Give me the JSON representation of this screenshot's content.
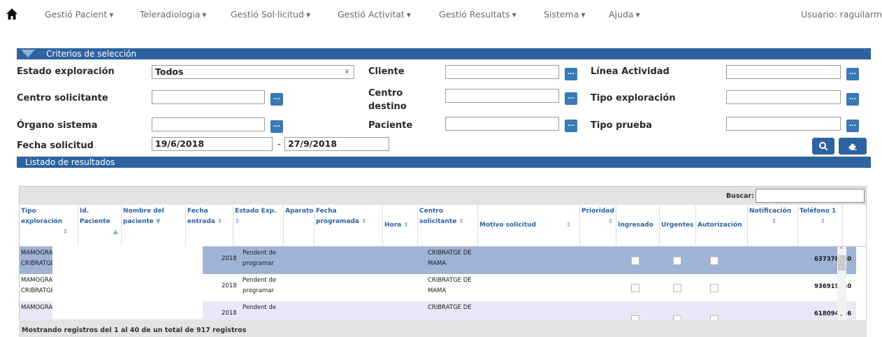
{
  "nav": {
    "items": [
      "Gestió Pacient",
      "Teleradiologia",
      "Gestió Sol·licitud",
      "Gestió Activitat",
      "Gestió Resultats",
      "Sistema",
      "Ajuda"
    ],
    "user": "Usuario: raguilarm"
  },
  "criteria": {
    "title": "Criterios de selección",
    "estado_label": "Estado exploración",
    "estado_value": "Todos",
    "centro_sol_label": "Centro solicitante",
    "organo_label": "Órgano sistema",
    "fecha_label": "Fecha solicitud",
    "fecha_desde": "19/6/2018",
    "fecha_sep": "-",
    "fecha_hasta": "27/9/2018",
    "cliente_label": "Cliente",
    "centro_dest_label": "Centro destino",
    "paciente_label": "Paciente",
    "linea_label": "Línea Actividad",
    "tipo_expl_label": "Tipo exploración",
    "tipo_prueba_label": "Tipo prueba",
    "dots": "..."
  },
  "results": {
    "title": "Listado de resultados",
    "buscar_label": "Buscar:",
    "columns": [
      "Tipo exploración",
      "Id. Paciente",
      "Nombre del paciente",
      "Fecha entrada",
      "Estado Exp.",
      "Aparato",
      "Fecha programada",
      "Hora",
      "Centro solicitante",
      "Motivo solicitud",
      "Prioridad",
      "Ingresado",
      "Urgentes",
      "Autorización",
      "Notificación",
      "Teléfono 1"
    ],
    "rows": [
      {
        "tipo": "MAMOGRAFIA CRIBRATGE",
        "fecha": "2018",
        "estado": "Pendent de programar",
        "centro": "CRIBRATGE DE MAMA",
        "tel": "637378350"
      },
      {
        "tipo": "MAMOGRAFIA CRIBRATGE",
        "fecha": "2018",
        "estado": "Pendent de programar",
        "centro": "CRIBRATGE DE MAMA",
        "tel": "936919030"
      },
      {
        "tipo": "MAMOGRAFIA",
        "fecha": "2018",
        "estado": "Pendent de",
        "centro": "CRIBRATGE DE",
        "tel": "618094446"
      }
    ],
    "footer": "Mostrando registros del 1 al 40 de un total de 917 registros"
  },
  "colors": {
    "accent": "#2d63a0",
    "row_selected": "#9fb3d6",
    "row_alt": "#e8e8f8"
  }
}
